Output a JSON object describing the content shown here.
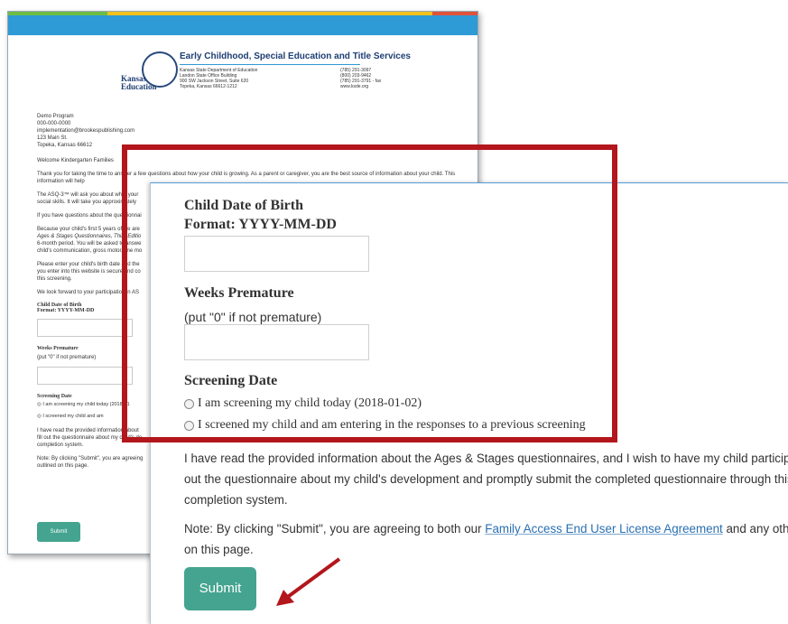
{
  "background_page": {
    "header": {
      "logo_text": "Kansas\nEducation",
      "org_title": "Early Childhood, Special Education and Title Services",
      "org_address": "Kansas State Department of Education\nLandon State Office Building\n900 SW Jackson Street, Suite 620\nTopeka, Kansas 66612-1212",
      "org_phones": "(785) 291-3097\n(800) 203-9462\n(785) 291-3791 - fax\nwww.ksde.org"
    },
    "address_lines": [
      "Demo Program",
      "000-000-0000",
      "implementation@brookespublishing.com",
      "123 Main St.",
      "Topeka, Kansas 66612"
    ],
    "paragraphs": [
      "Welcome Kindergarten Families",
      "Thank you for taking the time to answer a few questions about how your child is growing.  As a parent or caregiver, you are the best source of information about your child.  This information will help",
      "The ASQ-3™ will ask you about what your",
      "social skills.  It will take you approximately",
      "If you have questions about the questionnai",
      "Because your child's first 5 years of life are",
      "Ages & Stages Questionnaires, Third Editio",
      "6-month period. You will be asked to answe",
      "child's communication, gross motor, fine mo",
      "Please enter your child's birth date and the",
      "you enter into this website is secure and co",
      "this screening.",
      "We look forward to your participation in AS"
    ],
    "dob_label": "Child Date of Birth",
    "dob_format": "Format: YYYY-MM-DD",
    "weeks_label": "Weeks Premature",
    "weeks_hint": "(put \"0\" if not premature)",
    "screening_label": "Screening Date",
    "radio1": "I am screening my child today (2018-01",
    "radio2": "I screened my child and am",
    "consent_lines": [
      "I have read the provided information about",
      "fill out the questionnaire about my child's de",
      "completion system."
    ],
    "note_lines": [
      "Note: By clicking \"Submit\", you are agreeing",
      "outlined on this page."
    ],
    "submit_label": "Submit"
  },
  "zoom": {
    "dob_label": "Child Date of Birth",
    "dob_format": "Format: YYYY-MM-DD",
    "dob_value": "",
    "weeks_label": "Weeks Premature",
    "weeks_hint": "(put \"0\" if not premature)",
    "weeks_value": "",
    "screening_label": "Screening Date",
    "radio_today": "I am screening my child today (2018-01-02)",
    "radio_previous": "I screened my child and am entering in the responses to a previous screening",
    "consent_line1": "I have read the provided information about the Ages & Stages questionnaires, and I wish to have my child participat",
    "consent_line2": "out the questionnaire about my child's development and promptly submit the completed questionnaire through this",
    "consent_line3": "completion system.",
    "note_prefix": "Note: By clicking \"Submit\", you are agreeing to both our ",
    "note_link": "Family Access End User License Agreement",
    "note_suffix": " and any other",
    "note_line2": "on this page.",
    "submit_label": "Submit"
  },
  "colors": {
    "header_bar": "#2e9ad6",
    "accent_red": "#b3161c",
    "button_green": "#44a48f",
    "link_blue": "#2a6fb1"
  }
}
